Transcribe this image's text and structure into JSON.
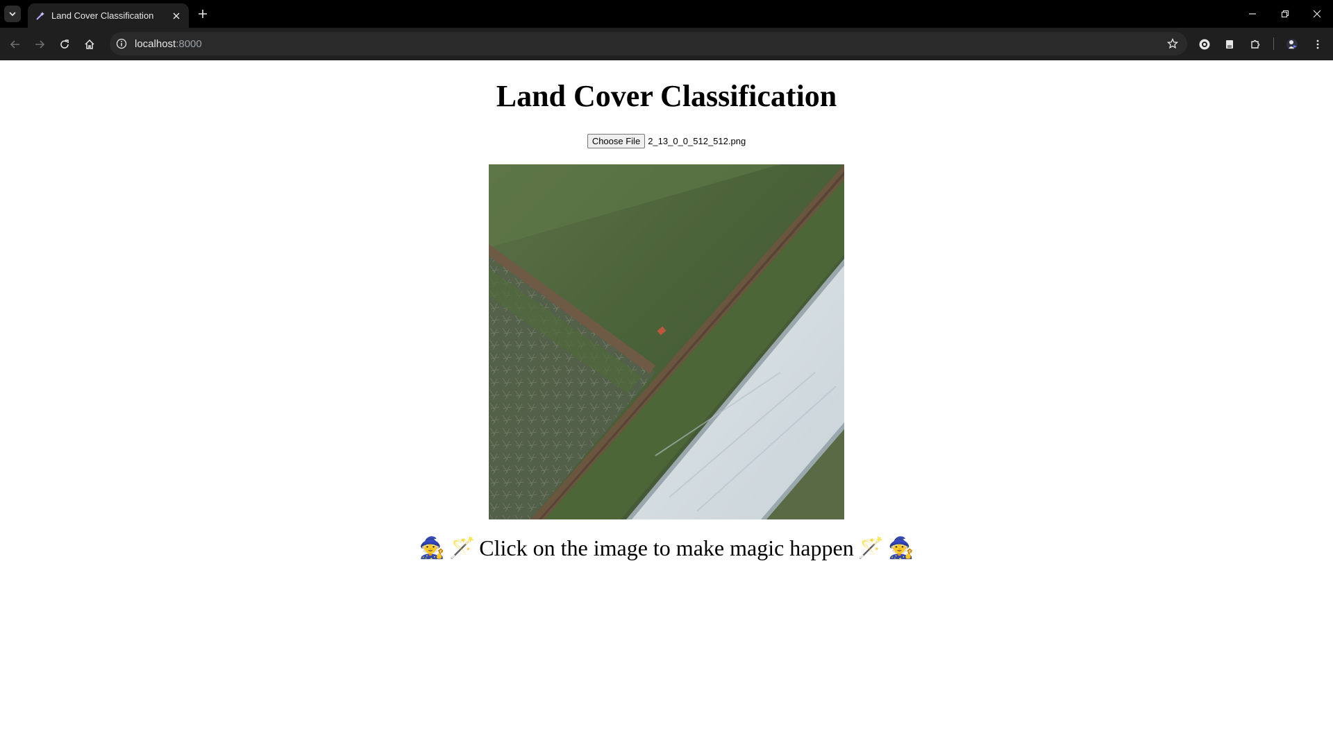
{
  "browser": {
    "tab_title": "Land Cover Classification",
    "url_host": "localhost",
    "url_port": ":8000"
  },
  "page": {
    "title": "Land Cover Classification",
    "file_button_label": "Choose File",
    "file_name": "2_13_0_0_512_512.png",
    "magic_text": "Click on the image to make magic happen",
    "emoji_left_outer": "🧙",
    "emoji_left_inner": "🪄",
    "emoji_right_inner": "🪄",
    "emoji_right_outer": "🧙"
  },
  "icons": {
    "tab_favicon": "magic-wand-icon",
    "tab_list": "chevron-down-icon",
    "close": "close-icon",
    "new_tab": "plus-icon",
    "back": "arrow-left-icon",
    "forward": "arrow-right-icon",
    "reload": "reload-icon",
    "home": "home-icon",
    "site_info": "info-icon",
    "bookmark": "star-icon",
    "extensions": "puzzle-icon",
    "menu": "kebab-menu-icon"
  },
  "colors": {
    "chrome_bg": "#000000",
    "toolbar_bg": "#1f1f1f",
    "omnibox_bg": "#2a2a2a",
    "page_bg": "#ffffff"
  }
}
